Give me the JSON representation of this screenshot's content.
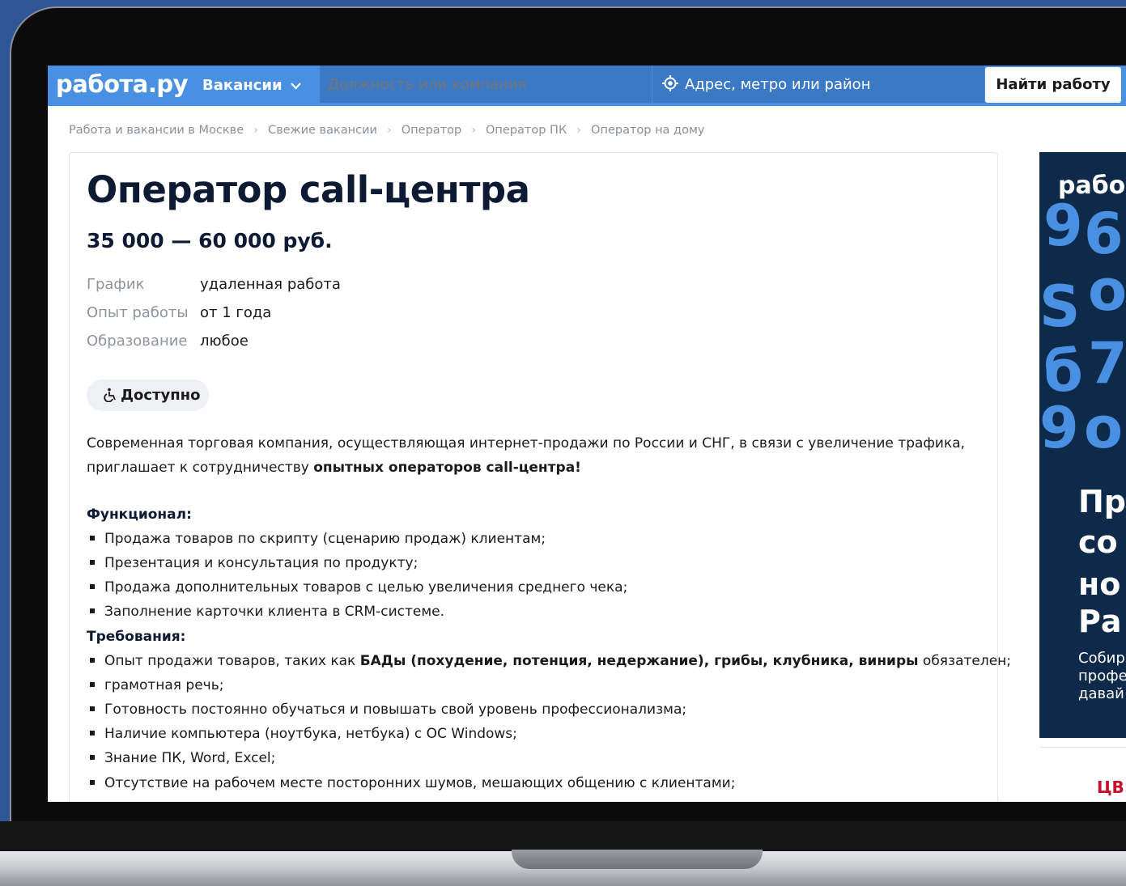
{
  "header": {
    "logo": "работа.ру",
    "vacancies_menu": "Вакансии",
    "search_placeholder": "Должность или компания",
    "address_placeholder": "Адрес, метро или район",
    "find_button": "Найти работу"
  },
  "breadcrumbs": [
    "Работа и вакансии в Москве",
    "Свежие вакансии",
    "Оператор",
    "Оператор ПК",
    "Оператор на дому"
  ],
  "vacancy": {
    "title": "Оператор call-центра",
    "salary": "35 000 — 60 000 руб.",
    "details": [
      {
        "key": "График",
        "value": "удаленная работа"
      },
      {
        "key": "Опыт работы",
        "value": "от 1 года"
      },
      {
        "key": "Образование",
        "value": "любое"
      }
    ],
    "accessible_badge": "Доступно",
    "intro_line1": "Современная торговая компания, осуществляющая интернет-продажи по России и СНГ, в связи с увеличение трафика,",
    "intro_line2_plain": "приглашает к сотрудничеству ",
    "intro_line2_bold": "опытных операторов call-центра!",
    "duties_heading": "Функционал:",
    "duties": [
      "Продажа товаров по скрипту (сценарию продаж) клиентам;",
      "Презентация и консультация по продукту;",
      "Продажа дополнительных товаров с целью увеличения среднего чека;",
      "Заполнение карточки клиента в CRM-системе."
    ],
    "requirements_heading": "Требования:",
    "req_first_prefix": "Опыт продажи товаров, таких как ",
    "req_first_bold": "БАДы (похудение, потенция, недержание), грибы, клубника, виниры",
    "req_first_suffix": " обязателен;",
    "requirements": [
      "грамотная речь;",
      "Готовность постоянно обучаться и повышать свой уровень профессионализма;",
      "Наличие компьютера (ноутбука, нетбука) с ОС Windows;",
      "Знание ПК, Word, Excel;",
      "Отсутствие на рабочем месте посторонних шумов, мешающих общению с клиентами;"
    ]
  },
  "ad": {
    "logo": "рабо",
    "lines": [
      "Пр",
      "со",
      "но",
      "Ра"
    ],
    "small": [
      "Собир",
      "профе",
      "давай"
    ],
    "brand2": "ЦВ"
  },
  "colors": {
    "brand_blue": "#4a90e2",
    "field_blue": "#3b79c4",
    "title": "#0d1a33",
    "ad_bg": "#0d2a4a"
  }
}
